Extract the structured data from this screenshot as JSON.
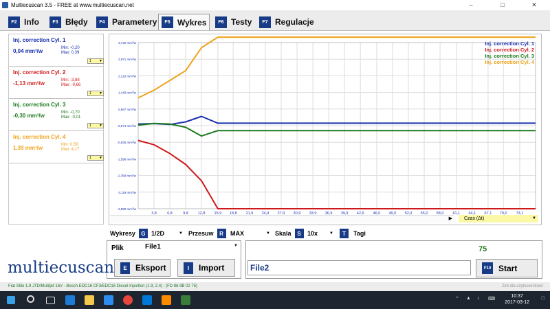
{
  "window": {
    "title": "Multiecuscan 3.5 - FREE at www.multiecuscan.net",
    "min_icon": "minimize-icon",
    "max_icon": "maximize-icon",
    "close_icon": "close-icon"
  },
  "tabs": [
    {
      "key": "F2",
      "label": "Info"
    },
    {
      "key": "F3",
      "label": "Błędy"
    },
    {
      "key": "F4",
      "label": "Parametery"
    },
    {
      "key": "F5",
      "label": "Wykres",
      "active": true
    },
    {
      "key": "F6",
      "label": "Testy"
    },
    {
      "key": "F7",
      "label": "Regulacje"
    }
  ],
  "cylinders": [
    {
      "name": "Inj. correction Cyl. 1",
      "value": "0,04 mm³/w",
      "min": "Min: -0,20",
      "max": "Max: 0,39",
      "sel": "1",
      "color": "#1a2fb0"
    },
    {
      "name": "Inj. correction Cyl. 2",
      "value": "-1,13 mm³/w",
      "min": "Min: -3,88",
      "max": "Max: -0,66",
      "sel": "1",
      "color": "#d01818"
    },
    {
      "name": "Inj. correction Cyl. 3",
      "value": "-0,30 mm³/w",
      "min": "Min: -0,70",
      "max": "Max: -0,01",
      "sel": "1",
      "color": "#1a7a1a"
    },
    {
      "name": "Inj. correction Cyl. 4",
      "value": "1,39 mm³/w",
      "min": "Min: 0,59",
      "max": "Max: 4,17",
      "sel": "1",
      "color": "#f0a21a"
    }
  ],
  "chart_data": {
    "type": "line",
    "x": [
      0.8,
      3.8,
      6.8,
      9.8,
      12.8,
      15.9,
      18.8,
      21.9,
      24.9,
      27.9,
      30.9,
      33.9,
      36.9,
      39.9,
      42.9,
      46.0,
      49.0,
      52.0,
      55.0,
      58.0,
      61.1,
      64.1,
      67.1,
      70.0,
      73.1,
      76.1
    ],
    "x_ticks": [
      "3,8",
      "6,8",
      "9,8",
      "12,8",
      "15,9",
      "18,8",
      "21,9",
      "24,9",
      "27,9",
      "30,9",
      "33,9",
      "36,9",
      "39,9",
      "42,9",
      "46,0",
      "49,0",
      "52,0",
      "55,0",
      "58,0",
      "61,1",
      "64,1",
      "67,1",
      "70,0",
      "73,1"
    ],
    "y_ticks": [
      "3,732 mm³/w",
      "2,971 mm³/w",
      "2,210 mm³/w",
      "1,449 mm³/w",
      "0,687 mm³/w",
      "-0,074 mm³/w",
      "-0,835 mm³/w",
      "-1,596 mm³/w",
      "-2,358 mm³/w",
      "-3,119 mm³/w",
      "-3,880 mm³/w"
    ],
    "ylim": [
      -3.88,
      3.732
    ],
    "xlim": [
      0.8,
      76.1
    ],
    "grid": true,
    "legend_position": "top-right",
    "series": [
      {
        "name": "Inj. correction Cyl. 1",
        "color": "#1a2fb0",
        "values": [
          0.0,
          0.02,
          -0.02,
          0.1,
          0.35,
          0.04,
          0.04,
          0.04,
          0.04,
          0.04,
          0.04,
          0.04,
          0.04,
          0.04,
          0.04,
          0.04,
          0.04,
          0.04,
          0.04,
          0.04,
          0.04,
          0.04,
          0.04,
          0.04,
          0.04,
          0.04
        ]
      },
      {
        "name": "Inj. correction Cyl. 2",
        "color": "#d01818",
        "values": [
          -0.75,
          -0.95,
          -1.35,
          -1.85,
          -2.6,
          -3.88,
          -3.88,
          -3.88,
          -3.88,
          -3.88,
          -3.88,
          -3.88,
          -3.88,
          -3.88,
          -3.88,
          -3.88,
          -3.88,
          -3.88,
          -3.88,
          -3.88,
          -3.88,
          -3.88,
          -3.88,
          -3.88,
          -3.88,
          -3.88
        ]
      },
      {
        "name": "Inj. correction Cyl. 3",
        "color": "#1a7a1a",
        "values": [
          -0.05,
          0.03,
          0.0,
          -0.15,
          -0.55,
          -0.3,
          -0.3,
          -0.3,
          -0.3,
          -0.3,
          -0.3,
          -0.3,
          -0.3,
          -0.3,
          -0.3,
          -0.3,
          -0.3,
          -0.3,
          -0.3,
          -0.3,
          -0.3,
          -0.3,
          -0.3,
          -0.3,
          -0.3,
          -0.3
        ]
      },
      {
        "name": "Inj. correction Cyl. 4",
        "color": "#f0a21a",
        "values": [
          1.2,
          1.55,
          2.0,
          2.45,
          3.5,
          4.17,
          4.17,
          4.17,
          4.17,
          4.17,
          4.17,
          4.17,
          4.17,
          4.17,
          4.17,
          4.17,
          4.17,
          4.17,
          4.17,
          4.17,
          4.17,
          4.17,
          4.17,
          4.17,
          4.17,
          4.17
        ]
      }
    ]
  },
  "time_select": {
    "label": "Czas (Δt)"
  },
  "controls": {
    "wykresy_label": "Wykresy",
    "wykresy_key": "G",
    "wykresy_value": "1/2D",
    "przesuw_label": "Przesuw",
    "przesuw_key": "R",
    "przesuw_value": "MAX",
    "skala_label": "Skala",
    "skala_key": "S",
    "skala_value": "10x",
    "tagi_key": "T",
    "tagi_label": "Tagi"
  },
  "file": {
    "plik_label": "Plik",
    "plik_value": "File1",
    "eksport_key": "E",
    "eksport_label": "Eksport",
    "import_key": "I",
    "import_label": "Import",
    "file2_value": "File2",
    "counter": "75",
    "start_key": "F10",
    "start_label": "Start"
  },
  "logo": "multiecuscan",
  "status": {
    "left": "Fiat Stilo 1.9 JTD/Multijet 16V - Bosch EDC16 CF3/EDC16 Diesel Injection (1.9, 2.4) - [FD 86 9B 02 75]",
    "right": "Zlot dla użytkowników!"
  },
  "taskbar": {
    "time": "10:37",
    "date": "2017-03-12"
  }
}
